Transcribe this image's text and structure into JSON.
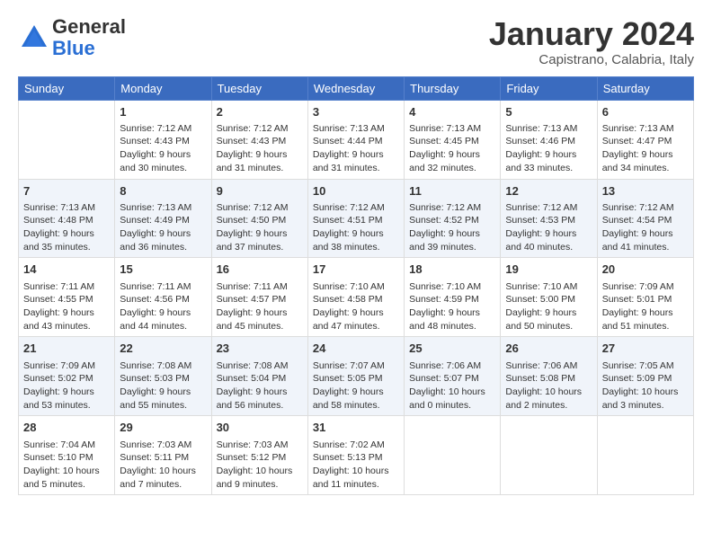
{
  "logo": {
    "general": "General",
    "blue": "Blue"
  },
  "header": {
    "month": "January 2024",
    "location": "Capistrano, Calabria, Italy"
  },
  "days": [
    "Sunday",
    "Monday",
    "Tuesday",
    "Wednesday",
    "Thursday",
    "Friday",
    "Saturday"
  ],
  "weeks": [
    [
      {
        "day": "",
        "info": ""
      },
      {
        "day": "1",
        "info": "Sunrise: 7:12 AM\nSunset: 4:43 PM\nDaylight: 9 hours\nand 30 minutes."
      },
      {
        "day": "2",
        "info": "Sunrise: 7:12 AM\nSunset: 4:43 PM\nDaylight: 9 hours\nand 31 minutes."
      },
      {
        "day": "3",
        "info": "Sunrise: 7:13 AM\nSunset: 4:44 PM\nDaylight: 9 hours\nand 31 minutes."
      },
      {
        "day": "4",
        "info": "Sunrise: 7:13 AM\nSunset: 4:45 PM\nDaylight: 9 hours\nand 32 minutes."
      },
      {
        "day": "5",
        "info": "Sunrise: 7:13 AM\nSunset: 4:46 PM\nDaylight: 9 hours\nand 33 minutes."
      },
      {
        "day": "6",
        "info": "Sunrise: 7:13 AM\nSunset: 4:47 PM\nDaylight: 9 hours\nand 34 minutes."
      }
    ],
    [
      {
        "day": "7",
        "info": "Sunrise: 7:13 AM\nSunset: 4:48 PM\nDaylight: 9 hours\nand 35 minutes."
      },
      {
        "day": "8",
        "info": "Sunrise: 7:13 AM\nSunset: 4:49 PM\nDaylight: 9 hours\nand 36 minutes."
      },
      {
        "day": "9",
        "info": "Sunrise: 7:12 AM\nSunset: 4:50 PM\nDaylight: 9 hours\nand 37 minutes."
      },
      {
        "day": "10",
        "info": "Sunrise: 7:12 AM\nSunset: 4:51 PM\nDaylight: 9 hours\nand 38 minutes."
      },
      {
        "day": "11",
        "info": "Sunrise: 7:12 AM\nSunset: 4:52 PM\nDaylight: 9 hours\nand 39 minutes."
      },
      {
        "day": "12",
        "info": "Sunrise: 7:12 AM\nSunset: 4:53 PM\nDaylight: 9 hours\nand 40 minutes."
      },
      {
        "day": "13",
        "info": "Sunrise: 7:12 AM\nSunset: 4:54 PM\nDaylight: 9 hours\nand 41 minutes."
      }
    ],
    [
      {
        "day": "14",
        "info": "Sunrise: 7:11 AM\nSunset: 4:55 PM\nDaylight: 9 hours\nand 43 minutes."
      },
      {
        "day": "15",
        "info": "Sunrise: 7:11 AM\nSunset: 4:56 PM\nDaylight: 9 hours\nand 44 minutes."
      },
      {
        "day": "16",
        "info": "Sunrise: 7:11 AM\nSunset: 4:57 PM\nDaylight: 9 hours\nand 45 minutes."
      },
      {
        "day": "17",
        "info": "Sunrise: 7:10 AM\nSunset: 4:58 PM\nDaylight: 9 hours\nand 47 minutes."
      },
      {
        "day": "18",
        "info": "Sunrise: 7:10 AM\nSunset: 4:59 PM\nDaylight: 9 hours\nand 48 minutes."
      },
      {
        "day": "19",
        "info": "Sunrise: 7:10 AM\nSunset: 5:00 PM\nDaylight: 9 hours\nand 50 minutes."
      },
      {
        "day": "20",
        "info": "Sunrise: 7:09 AM\nSunset: 5:01 PM\nDaylight: 9 hours\nand 51 minutes."
      }
    ],
    [
      {
        "day": "21",
        "info": "Sunrise: 7:09 AM\nSunset: 5:02 PM\nDaylight: 9 hours\nand 53 minutes."
      },
      {
        "day": "22",
        "info": "Sunrise: 7:08 AM\nSunset: 5:03 PM\nDaylight: 9 hours\nand 55 minutes."
      },
      {
        "day": "23",
        "info": "Sunrise: 7:08 AM\nSunset: 5:04 PM\nDaylight: 9 hours\nand 56 minutes."
      },
      {
        "day": "24",
        "info": "Sunrise: 7:07 AM\nSunset: 5:05 PM\nDaylight: 9 hours\nand 58 minutes."
      },
      {
        "day": "25",
        "info": "Sunrise: 7:06 AM\nSunset: 5:07 PM\nDaylight: 10 hours\nand 0 minutes."
      },
      {
        "day": "26",
        "info": "Sunrise: 7:06 AM\nSunset: 5:08 PM\nDaylight: 10 hours\nand 2 minutes."
      },
      {
        "day": "27",
        "info": "Sunrise: 7:05 AM\nSunset: 5:09 PM\nDaylight: 10 hours\nand 3 minutes."
      }
    ],
    [
      {
        "day": "28",
        "info": "Sunrise: 7:04 AM\nSunset: 5:10 PM\nDaylight: 10 hours\nand 5 minutes."
      },
      {
        "day": "29",
        "info": "Sunrise: 7:03 AM\nSunset: 5:11 PM\nDaylight: 10 hours\nand 7 minutes."
      },
      {
        "day": "30",
        "info": "Sunrise: 7:03 AM\nSunset: 5:12 PM\nDaylight: 10 hours\nand 9 minutes."
      },
      {
        "day": "31",
        "info": "Sunrise: 7:02 AM\nSunset: 5:13 PM\nDaylight: 10 hours\nand 11 minutes."
      },
      {
        "day": "",
        "info": ""
      },
      {
        "day": "",
        "info": ""
      },
      {
        "day": "",
        "info": ""
      }
    ]
  ]
}
